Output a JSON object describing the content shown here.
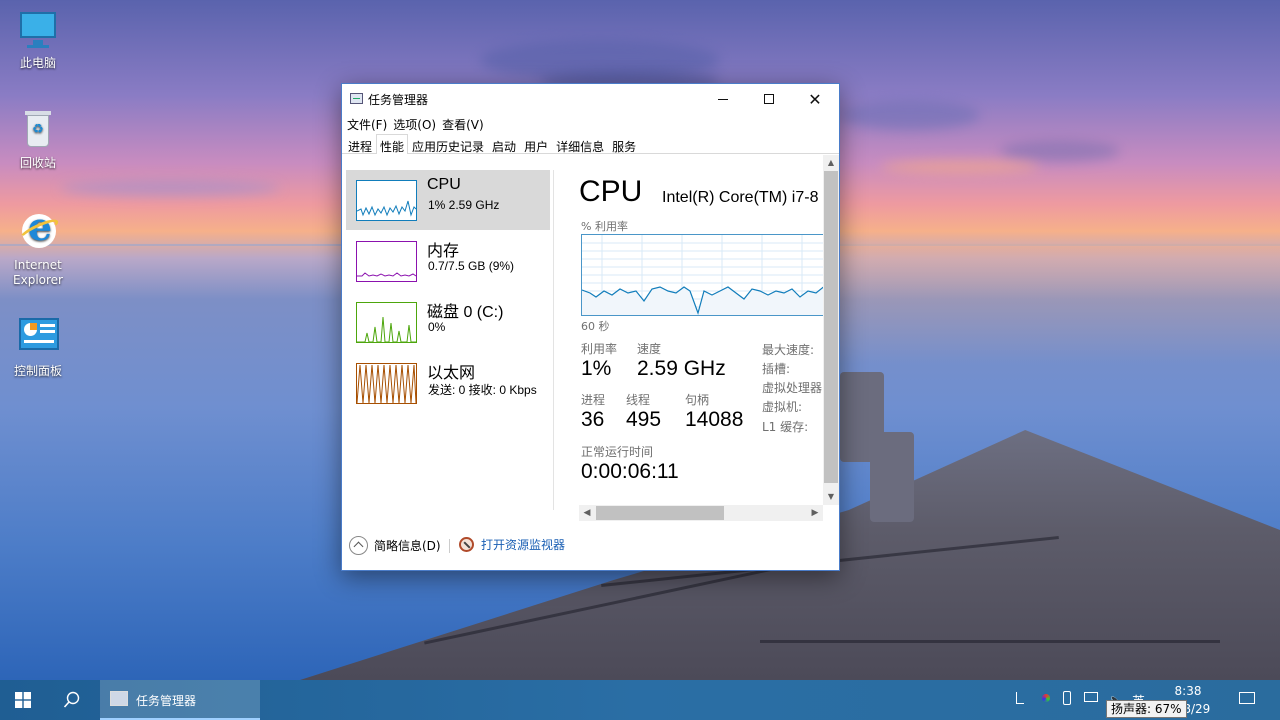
{
  "desktop": {
    "icons": [
      {
        "label": "此电脑"
      },
      {
        "label": "回收站"
      },
      {
        "label": "Internet Explorer"
      },
      {
        "label": "控制面板"
      }
    ]
  },
  "window": {
    "title": "任务管理器",
    "menu": [
      "文件(F)",
      "选项(O)",
      "查看(V)"
    ],
    "tabs": [
      "进程",
      "性能",
      "应用历史记录",
      "启动",
      "用户",
      "详细信息",
      "服务"
    ],
    "active_tab": "性能",
    "resources": [
      {
        "name": "CPU",
        "detail": "1%  2.59 GHz",
        "color": "#117dbb"
      },
      {
        "name": "内存",
        "detail": "0.7/7.5 GB (9%)",
        "color": "#8b12ae"
      },
      {
        "name": "磁盘 0 (C:)",
        "detail": "0%",
        "color": "#4da60c"
      },
      {
        "name": "以太网",
        "detail": "发送: 0 接收: 0 Kbps",
        "color": "#a74f01"
      }
    ],
    "cpu": {
      "heading": "CPU",
      "model": "Intel(R) Core(TM) i7-8",
      "graph_label": "% 利用率",
      "graph_time": "60 秒",
      "stats": {
        "util_label": "利用率",
        "util_value": "1%",
        "speed_label": "速度",
        "speed_value": "2.59 GHz",
        "proc_label": "进程",
        "proc_value": "36",
        "threads_label": "线程",
        "threads_value": "495",
        "handles_label": "句柄",
        "handles_value": "14088",
        "uptime_label": "正常运行时间",
        "uptime_value": "0:00:06:11"
      },
      "side": [
        "最大速度:",
        "插槽:",
        "虚拟处理器",
        "虚拟机:",
        "L1 缓存:"
      ]
    },
    "footer": {
      "fewer_details": "简略信息(D)",
      "resource_monitor": "打开资源监视器"
    }
  },
  "taskbar": {
    "active_app": "任务管理器",
    "ime": "英",
    "time": "8:38",
    "date": "4/8/29",
    "tooltip": "扬声器: 67%"
  }
}
